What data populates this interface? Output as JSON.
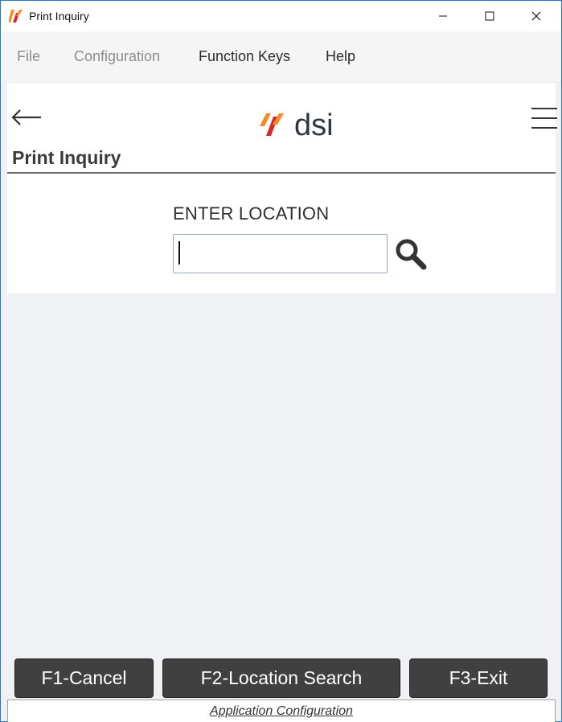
{
  "window": {
    "title": "Print Inquiry"
  },
  "menu": {
    "file": "File",
    "configuration": "Configuration",
    "function_keys": "Function Keys",
    "help": "Help"
  },
  "header": {
    "logo_text": "dsi",
    "page_title": "Print Inquiry"
  },
  "form": {
    "location_label": "ENTER LOCATION",
    "location_value": ""
  },
  "function_keys": {
    "f1": "F1-Cancel",
    "f2": "F2-Location Search",
    "f3": "F3-Exit"
  },
  "footer": {
    "link": "Application Configuration"
  },
  "colors": {
    "brand_orange": "#f28c28",
    "brand_red": "#d9262b",
    "logo_text": "#2f3740",
    "button_bg": "#404040"
  }
}
